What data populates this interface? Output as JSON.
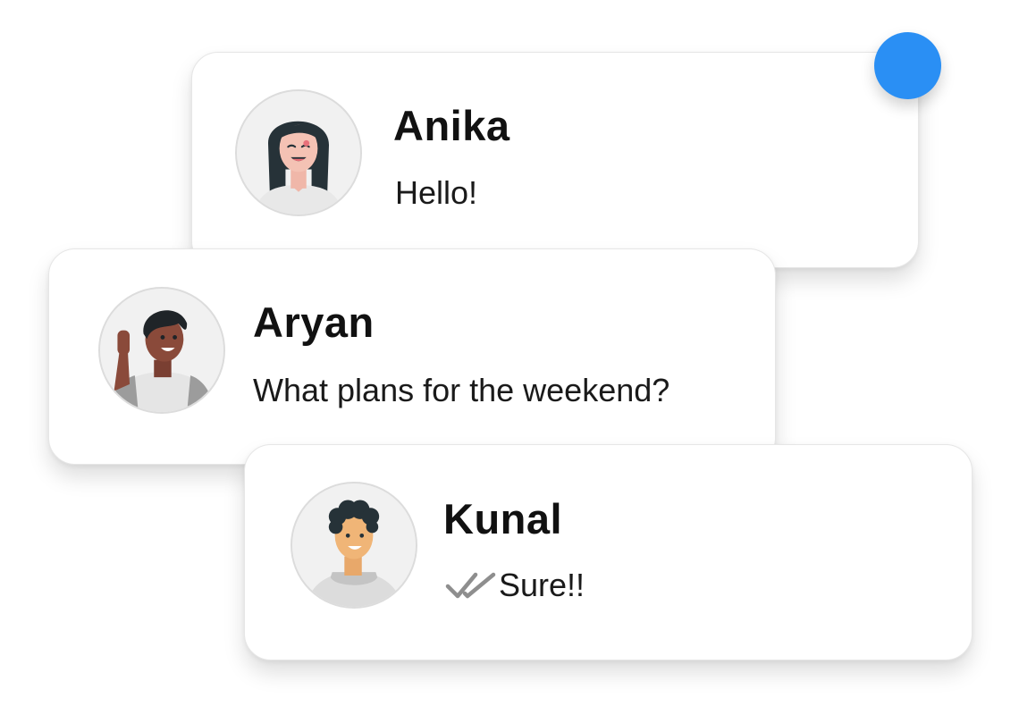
{
  "unread_indicator_color": "#2a8ff4",
  "messages": [
    {
      "sender": "Anika",
      "text": "Hello!",
      "avatar_icon": "woman-avatar-icon",
      "unread": true
    },
    {
      "sender": "Aryan",
      "text": "What plans for the weekend?",
      "avatar_icon": "man-waving-avatar-icon"
    },
    {
      "sender": "Kunal",
      "text": "Sure!!",
      "avatar_icon": "man-curly-hair-avatar-icon",
      "status_icon": "double-check-icon"
    }
  ]
}
